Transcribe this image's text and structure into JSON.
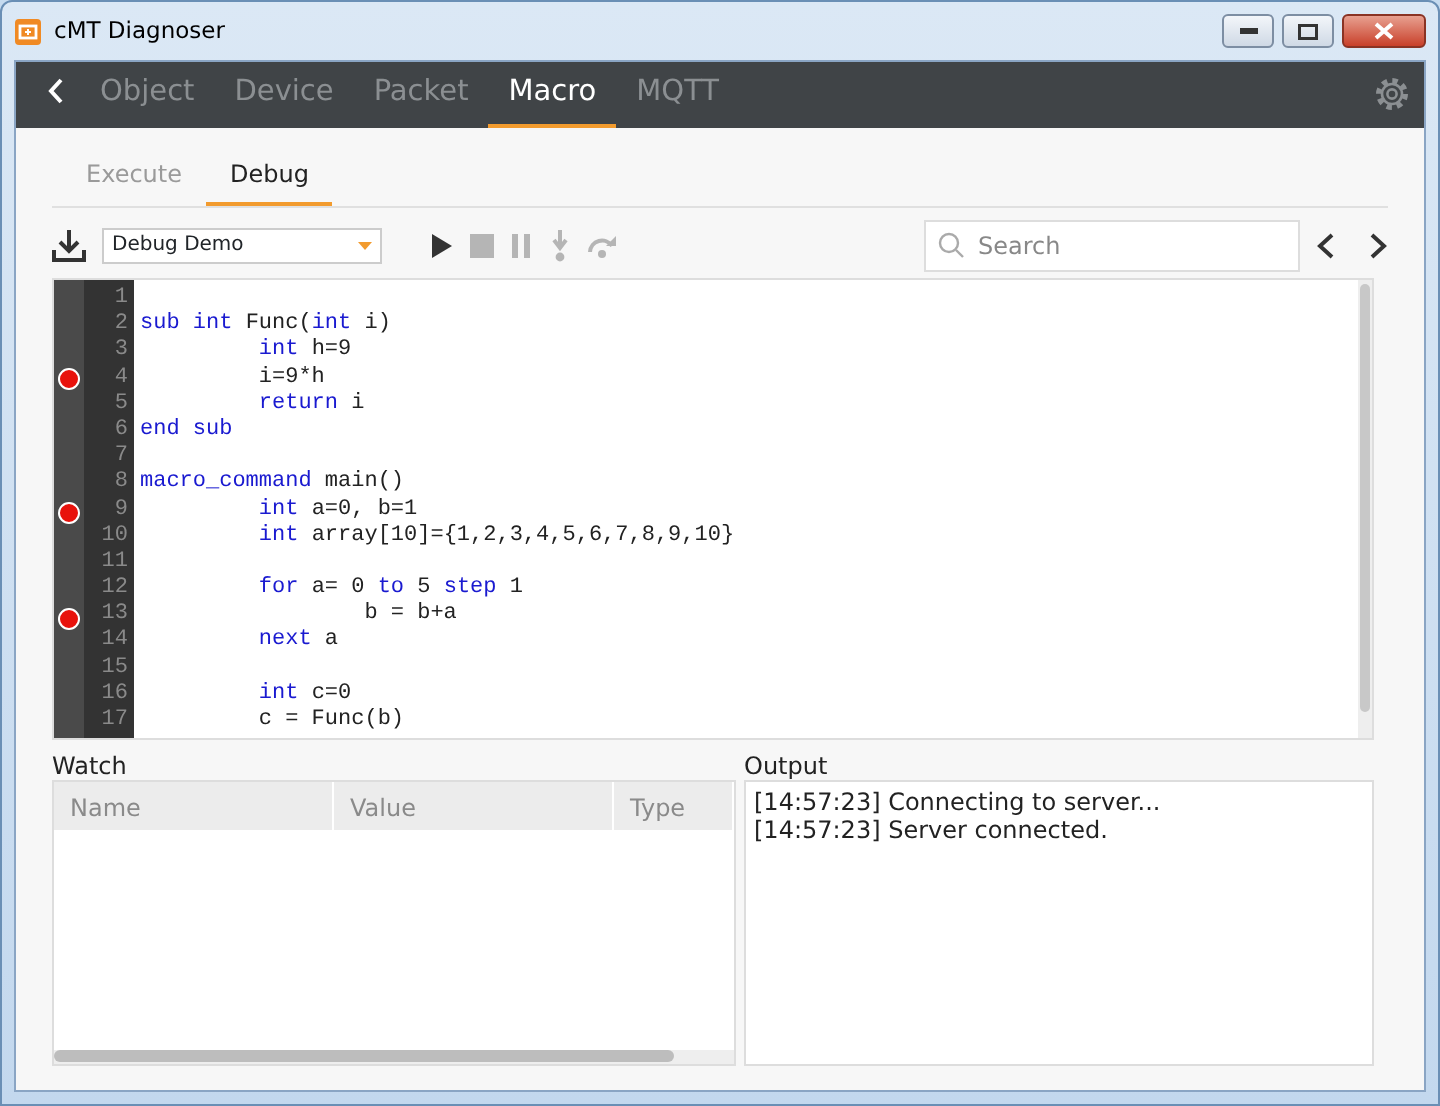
{
  "window": {
    "title": "cMT Diagnoser"
  },
  "nav_tabs": [
    {
      "label": "Object",
      "selected": false
    },
    {
      "label": "Device",
      "selected": false
    },
    {
      "label": "Packet",
      "selected": false
    },
    {
      "label": "Macro",
      "selected": true
    },
    {
      "label": "MQTT",
      "selected": false
    }
  ],
  "sub_tabs": [
    {
      "label": "Execute",
      "selected": false
    },
    {
      "label": "Debug",
      "selected": true
    }
  ],
  "toolbar": {
    "macro_select": "Debug Demo",
    "search": {
      "placeholder": "Search"
    }
  },
  "code_lines": [
    {
      "number": "1",
      "breakpoint": false
    },
    {
      "number": "2",
      "breakpoint": false,
      "indented": false,
      "nested": false,
      "segments": [
        {
          "kind": "keyword",
          "text": "sub int"
        },
        {
          "kind": "plain",
          "text": " Func("
        },
        {
          "kind": "keyword",
          "text": "int"
        },
        {
          "kind": "plain",
          "text": " i)"
        }
      ]
    },
    {
      "number": "3",
      "breakpoint": false,
      "indented": true,
      "nested": false,
      "segments": [
        {
          "kind": "keyword",
          "text": "int"
        },
        {
          "kind": "plain",
          "text": " h=9"
        }
      ]
    },
    {
      "number": "4",
      "breakpoint": true,
      "indented": true,
      "nested": false,
      "segments": [
        {
          "kind": "plain",
          "text": "i=9*h"
        }
      ]
    },
    {
      "number": "5",
      "breakpoint": false,
      "indented": true,
      "nested": false,
      "segments": [
        {
          "kind": "keyword",
          "text": "return"
        },
        {
          "kind": "plain",
          "text": " i"
        }
      ]
    },
    {
      "number": "6",
      "breakpoint": false,
      "indented": false,
      "nested": false,
      "segments": [
        {
          "kind": "keyword",
          "text": "end sub"
        }
      ]
    },
    {
      "number": "7",
      "breakpoint": false
    },
    {
      "number": "8",
      "breakpoint": false,
      "indented": false,
      "nested": false,
      "segments": [
        {
          "kind": "keyword",
          "text": "macro_command"
        },
        {
          "kind": "plain",
          "text": " main()"
        }
      ]
    },
    {
      "number": "9",
      "breakpoint": true,
      "indented": true,
      "nested": false,
      "segments": [
        {
          "kind": "keyword",
          "text": "int"
        },
        {
          "kind": "plain",
          "text": " a=0, b=1"
        }
      ]
    },
    {
      "number": "10",
      "breakpoint": false,
      "indented": true,
      "nested": false,
      "segments": [
        {
          "kind": "keyword",
          "text": "int"
        },
        {
          "kind": "plain",
          "text": " array[10]={1,2,3,4,5,6,7,8,9,10}"
        }
      ]
    },
    {
      "number": "11",
      "breakpoint": false
    },
    {
      "number": "12",
      "breakpoint": false,
      "indented": true,
      "nested": false,
      "segments": [
        {
          "kind": "keyword",
          "text": "for"
        },
        {
          "kind": "plain",
          "text": " a= 0 "
        },
        {
          "kind": "keyword",
          "text": "to"
        },
        {
          "kind": "plain",
          "text": " 5 "
        },
        {
          "kind": "keyword",
          "text": "step"
        },
        {
          "kind": "plain",
          "text": " 1"
        }
      ]
    },
    {
      "number": "13",
      "breakpoint": true,
      "indented": true,
      "nested": true,
      "segments": [
        {
          "kind": "plain",
          "text": "b = b+a"
        }
      ]
    },
    {
      "number": "14",
      "breakpoint": false,
      "indented": true,
      "nested": false,
      "segments": [
        {
          "kind": "keyword",
          "text": "next"
        },
        {
          "kind": "plain",
          "text": " a"
        }
      ]
    },
    {
      "number": "15",
      "breakpoint": false
    },
    {
      "number": "16",
      "breakpoint": false,
      "indented": true,
      "nested": false,
      "segments": [
        {
          "kind": "keyword",
          "text": "int"
        },
        {
          "kind": "plain",
          "text": " c=0"
        }
      ]
    },
    {
      "number": "17",
      "breakpoint": false,
      "indented": true,
      "nested": false,
      "segments": [
        {
          "kind": "plain",
          "text": "c = Func(b)"
        }
      ]
    }
  ],
  "watch": {
    "title": "Watch",
    "columns": [
      "Name",
      "Value",
      "Type"
    ]
  },
  "output": {
    "title": "Output",
    "lines": [
      "[14:57:23] Connecting to server...",
      "[14:57:23] Server connected."
    ]
  }
}
